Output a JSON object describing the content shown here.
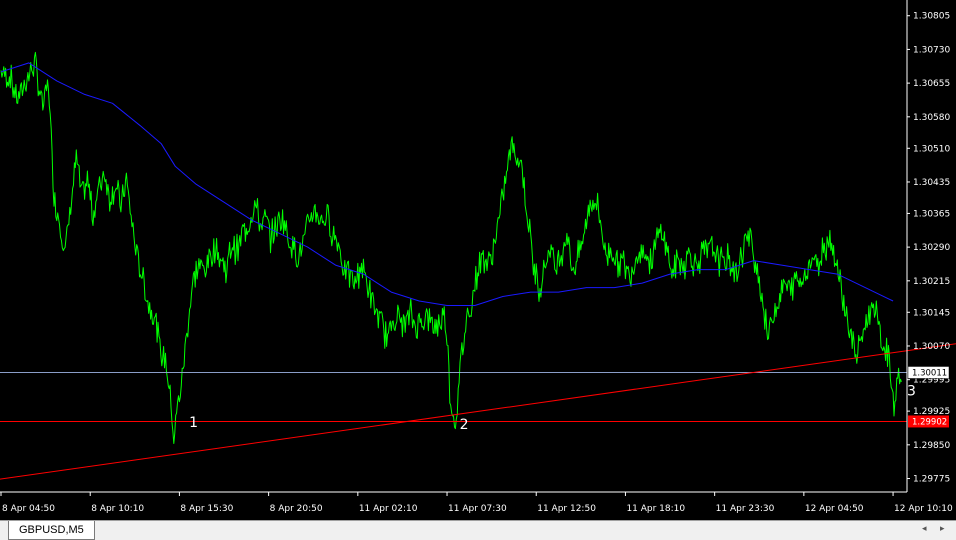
{
  "colors": {
    "background": "#000000",
    "price_line": "#00ff00",
    "moving_average": "#1a1aff",
    "trendline": "#ff0000",
    "support_line": "#ff0000",
    "bid_line": "#8a9dc8",
    "axis": "#ffffff"
  },
  "tab": {
    "symbol_label": "GBPUSD,M5"
  },
  "scroll": {
    "left_icon": "chevron-left-icon",
    "right_icon": "chevron-right-icon"
  },
  "chart_data": {
    "type": "line",
    "title": "",
    "symbol": "GBPUSD",
    "timeframe": "M5",
    "ylim": [
      1.29745,
      1.3084
    ],
    "y_ticks": [
      "1.30805",
      "1.30730",
      "1.30655",
      "1.30580",
      "1.30510",
      "1.30435",
      "1.30365",
      "1.30290",
      "1.30215",
      "1.30145",
      "1.30070",
      "1.29995",
      "1.29925",
      "1.29850",
      "1.29775"
    ],
    "x_ticks": [
      "8 Apr 04:50",
      "8 Apr 10:10",
      "8 Apr 15:30",
      "8 Apr 20:50",
      "11 Apr 02:10",
      "11 Apr 07:30",
      "11 Apr 12:50",
      "11 Apr 18:10",
      "11 Apr 23:30",
      "12 Apr 04:50",
      "12 Apr 10:10"
    ],
    "x_tick_index": [
      0,
      64,
      128,
      192,
      256,
      320,
      384,
      448,
      512,
      576,
      640
    ],
    "bars_visible": 650,
    "grid": false,
    "series": [
      {
        "role": "price",
        "points": [
          [
            0,
            1.3068
          ],
          [
            6,
            1.3067
          ],
          [
            12,
            1.3062
          ],
          [
            18,
            1.3066
          ],
          [
            24,
            1.307
          ],
          [
            30,
            1.306
          ],
          [
            34,
            1.3066
          ],
          [
            38,
            1.304
          ],
          [
            42,
            1.3035
          ],
          [
            46,
            1.3028
          ],
          [
            50,
            1.3038
          ],
          [
            54,
            1.3049
          ],
          [
            58,
            1.304
          ],
          [
            62,
            1.3044
          ],
          [
            66,
            1.3036
          ],
          [
            70,
            1.3042
          ],
          [
            74,
            1.3046
          ],
          [
            78,
            1.304
          ],
          [
            82,
            1.3043
          ],
          [
            86,
            1.3038
          ],
          [
            90,
            1.3044
          ],
          [
            94,
            1.3034
          ],
          [
            98,
            1.3026
          ],
          [
            102,
            1.3022
          ],
          [
            106,
            1.3016
          ],
          [
            110,
            1.3014
          ],
          [
            114,
            1.3006
          ],
          [
            118,
            1.3004
          ],
          [
            122,
            1.2994
          ],
          [
            124,
            1.2986
          ],
          [
            126,
            1.2992
          ],
          [
            130,
            1.3
          ],
          [
            134,
            1.3012
          ],
          [
            138,
            1.3022
          ],
          [
            142,
            1.3025
          ],
          [
            146,
            1.3024
          ],
          [
            150,
            1.3027
          ],
          [
            154,
            1.3029
          ],
          [
            158,
            1.3026
          ],
          [
            162,
            1.3024
          ],
          [
            166,
            1.303
          ],
          [
            170,
            1.3028
          ],
          [
            174,
            1.3033
          ],
          [
            178,
            1.3034
          ],
          [
            182,
            1.3039
          ],
          [
            186,
            1.3034
          ],
          [
            190,
            1.3035
          ],
          [
            194,
            1.3031
          ],
          [
            198,
            1.3034
          ],
          [
            202,
            1.3036
          ],
          [
            206,
            1.3031
          ],
          [
            210,
            1.3029
          ],
          [
            214,
            1.3027
          ],
          [
            218,
            1.3031
          ],
          [
            222,
            1.3036
          ],
          [
            226,
            1.3037
          ],
          [
            230,
            1.3035
          ],
          [
            234,
            1.3036
          ],
          [
            238,
            1.3032
          ],
          [
            242,
            1.303
          ],
          [
            246,
            1.3024
          ],
          [
            250,
            1.3023
          ],
          [
            254,
            1.3021
          ],
          [
            258,
            1.3025
          ],
          [
            262,
            1.3022
          ],
          [
            266,
            1.3017
          ],
          [
            270,
            1.3014
          ],
          [
            274,
            1.3011
          ],
          [
            278,
            1.3009
          ],
          [
            282,
            1.3014
          ],
          [
            286,
            1.3013
          ],
          [
            290,
            1.3012
          ],
          [
            294,
            1.3014
          ],
          [
            298,
            1.3011
          ],
          [
            302,
            1.3013
          ],
          [
            306,
            1.3014
          ],
          [
            310,
            1.3011
          ],
          [
            314,
            1.3012
          ],
          [
            318,
            1.3014
          ],
          [
            320,
            1.301
          ],
          [
            322,
            1.2997
          ],
          [
            324,
            1.2992
          ],
          [
            326,
            1.299
          ],
          [
            328,
            1.2996
          ],
          [
            330,
            1.3004
          ],
          [
            334,
            1.3013
          ],
          [
            338,
            1.3017
          ],
          [
            342,
            1.3024
          ],
          [
            346,
            1.3027
          ],
          [
            350,
            1.3025
          ],
          [
            354,
            1.303
          ],
          [
            358,
            1.3036
          ],
          [
            362,
            1.3044
          ],
          [
            366,
            1.3052
          ],
          [
            370,
            1.3049
          ],
          [
            374,
            1.3047
          ],
          [
            378,
            1.3035
          ],
          [
            382,
            1.3025
          ],
          [
            386,
            1.302
          ],
          [
            390,
            1.3025
          ],
          [
            394,
            1.3029
          ],
          [
            398,
            1.3024
          ],
          [
            402,
            1.3028
          ],
          [
            406,
            1.3032
          ],
          [
            410,
            1.3024
          ],
          [
            414,
            1.3027
          ],
          [
            418,
            1.3031
          ],
          [
            422,
            1.3038
          ],
          [
            426,
            1.304
          ],
          [
            430,
            1.3035
          ],
          [
            434,
            1.3027
          ],
          [
            438,
            1.3029
          ],
          [
            442,
            1.3025
          ],
          [
            446,
            1.3026
          ],
          [
            450,
            1.3023
          ],
          [
            454,
            1.3025
          ],
          [
            458,
            1.3029
          ],
          [
            462,
            1.3028
          ],
          [
            466,
            1.3025
          ],
          [
            470,
            1.303
          ],
          [
            474,
            1.3033
          ],
          [
            478,
            1.3028
          ],
          [
            482,
            1.3023
          ],
          [
            486,
            1.3026
          ],
          [
            490,
            1.3025
          ],
          [
            494,
            1.3028
          ],
          [
            498,
            1.3025
          ],
          [
            502,
            1.3027
          ],
          [
            506,
            1.3028
          ],
          [
            510,
            1.3029
          ],
          [
            514,
            1.3027
          ],
          [
            518,
            1.3025
          ],
          [
            522,
            1.3027
          ],
          [
            526,
            1.3023
          ],
          [
            530,
            1.3025
          ],
          [
            534,
            1.3031
          ],
          [
            538,
            1.303
          ],
          [
            542,
            1.3025
          ],
          [
            546,
            1.3018
          ],
          [
            550,
            1.3009
          ],
          [
            554,
            1.3014
          ],
          [
            558,
            1.3017
          ],
          [
            562,
            1.3021
          ],
          [
            566,
            1.3019
          ],
          [
            570,
            1.3022
          ],
          [
            574,
            1.3021
          ],
          [
            578,
            1.3024
          ],
          [
            582,
            1.3027
          ],
          [
            586,
            1.3025
          ],
          [
            590,
            1.3029
          ],
          [
            594,
            1.3031
          ],
          [
            598,
            1.3028
          ],
          [
            602,
            1.3021
          ],
          [
            606,
            1.3015
          ],
          [
            610,
            1.3009
          ],
          [
            614,
            1.3004
          ],
          [
            618,
            1.301
          ],
          [
            622,
            1.3013
          ],
          [
            626,
            1.3017
          ],
          [
            630,
            1.301
          ],
          [
            634,
            1.3006
          ],
          [
            638,
            1.3003
          ],
          [
            640,
            1.2994
          ],
          [
            642,
            1.2997
          ],
          [
            644,
            1.3001
          ],
          [
            646,
            1.2999
          ]
        ]
      },
      {
        "role": "moving-average",
        "points": [
          [
            0,
            1.3068
          ],
          [
            20,
            1.307
          ],
          [
            40,
            1.3066
          ],
          [
            60,
            1.3063
          ],
          [
            80,
            1.3061
          ],
          [
            100,
            1.3056
          ],
          [
            115,
            1.3052
          ],
          [
            125,
            1.3047
          ],
          [
            140,
            1.3043
          ],
          [
            160,
            1.3039
          ],
          [
            180,
            1.3035
          ],
          [
            200,
            1.3032
          ],
          [
            220,
            1.3029
          ],
          [
            240,
            1.3025
          ],
          [
            260,
            1.3023
          ],
          [
            280,
            1.3019
          ],
          [
            300,
            1.3017
          ],
          [
            320,
            1.3016
          ],
          [
            340,
            1.3016
          ],
          [
            360,
            1.3018
          ],
          [
            380,
            1.3019
          ],
          [
            400,
            1.3019
          ],
          [
            420,
            1.302
          ],
          [
            440,
            1.302
          ],
          [
            460,
            1.3021
          ],
          [
            480,
            1.3023
          ],
          [
            500,
            1.3024
          ],
          [
            520,
            1.3024
          ],
          [
            540,
            1.3026
          ],
          [
            560,
            1.3025
          ],
          [
            580,
            1.3024
          ],
          [
            600,
            1.3023
          ],
          [
            620,
            1.302
          ],
          [
            640,
            1.3017
          ]
        ]
      }
    ],
    "horizontal_lines": [
      {
        "role": "bid",
        "value": 1.30011,
        "label": "1.30011"
      },
      {
        "role": "support",
        "value": 1.29902,
        "label": "1.29902"
      }
    ],
    "trendline": {
      "from": [
        -5,
        1.29772
      ],
      "to": [
        956,
        1.30075
      ]
    },
    "annotations": [
      {
        "text": "1",
        "at": [
          135,
          1.2989
        ]
      },
      {
        "text": "2",
        "at": [
          329,
          1.29885
        ]
      },
      {
        "text": "3",
        "at": [
          650,
          1.2996
        ]
      }
    ]
  }
}
